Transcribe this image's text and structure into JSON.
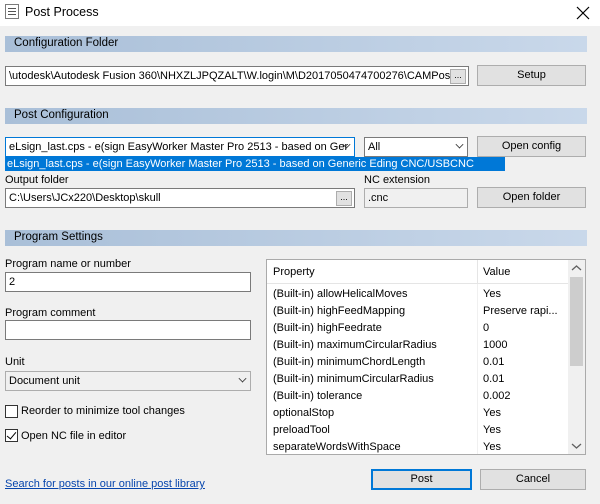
{
  "window": {
    "title": "Post Process"
  },
  "config_folder": {
    "header": "Configuration Folder",
    "path": "\\utodesk\\Autodesk Fusion 360\\NHXZLJPQZALT\\W.login\\M\\D2017050474700276\\CAMPosts",
    "browse_label": "...",
    "setup_label": "Setup"
  },
  "post_config": {
    "header": "Post Configuration",
    "selected": "eLsign_last.cps - e(sign EasyWorker Master Pro 2513 - based on Ger",
    "dropdown_item": "eLsign_last.cps - e(sign EasyWorker Master Pro 2513 - based on Generic Eding CNC/USBCNC",
    "filter": "All",
    "open_config_label": "Open config",
    "output_folder_label": "Output folder",
    "output_folder": "C:\\Users\\JCx220\\Desktop\\skull",
    "browse_label": "...",
    "nc_extension_label": "NC extension",
    "nc_extension": ".cnc",
    "open_folder_label": "Open folder"
  },
  "program_settings": {
    "header": "Program Settings",
    "program_name_label": "Program name or number",
    "program_name": "2",
    "program_comment_label": "Program comment",
    "program_comment": "",
    "unit_label": "Unit",
    "unit": "Document unit",
    "reorder_label": "Reorder to minimize tool changes",
    "reorder_checked": false,
    "open_nc_label": "Open NC file in editor",
    "open_nc_checked": true
  },
  "properties": {
    "col_property": "Property",
    "col_value": "Value",
    "rows": [
      {
        "property": "(Built-in) allowHelicalMoves",
        "value": "Yes"
      },
      {
        "property": "(Built-in) highFeedMapping",
        "value": "Preserve rapi..."
      },
      {
        "property": "(Built-in) highFeedrate",
        "value": "0"
      },
      {
        "property": "(Built-in) maximumCircularRadius",
        "value": "1000"
      },
      {
        "property": "(Built-in) minimumChordLength",
        "value": "0.01"
      },
      {
        "property": "(Built-in) minimumCircularRadius",
        "value": "0.01"
      },
      {
        "property": "(Built-in) tolerance",
        "value": "0.002"
      },
      {
        "property": "optionalStop",
        "value": "Yes"
      },
      {
        "property": "preloadTool",
        "value": "Yes"
      },
      {
        "property": "separateWordsWithSpace",
        "value": "Yes"
      }
    ]
  },
  "footer": {
    "search_link": "Search for posts in our online post library",
    "post_label": "Post",
    "cancel_label": "Cancel"
  },
  "colors": {
    "accent": "#0078d7",
    "section_header": "#b8cbe0",
    "link": "#0645ad"
  },
  "icons": {
    "window": "document-icon",
    "close": "close-icon"
  }
}
